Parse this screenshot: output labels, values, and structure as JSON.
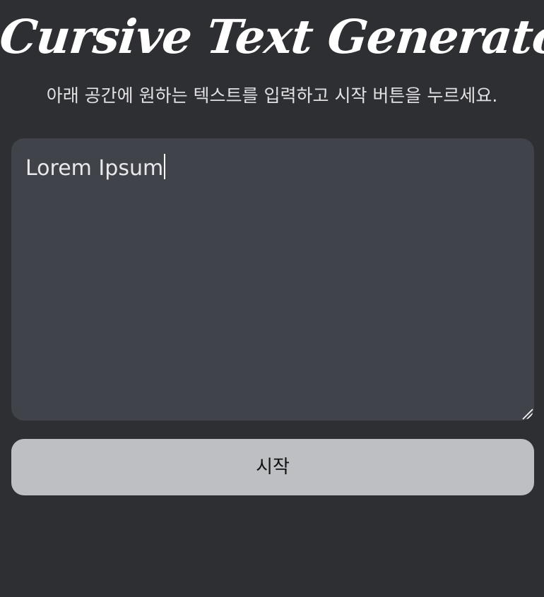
{
  "header": {
    "title": "Cursive Text Generator",
    "subtitle": "아래 공간에 원하는 텍스트를 입력하고 시작 버튼을 누르세요."
  },
  "editor": {
    "value": "Lorem Ipsum",
    "resize_handle_icon": "resize-grip-icon"
  },
  "actions": {
    "start_label": "시작"
  },
  "colors": {
    "background": "#2e2f33",
    "textarea_background": "#41434a",
    "button_background": "#bebfc3",
    "text": "#e6e6e8",
    "title": "#ffffff"
  }
}
